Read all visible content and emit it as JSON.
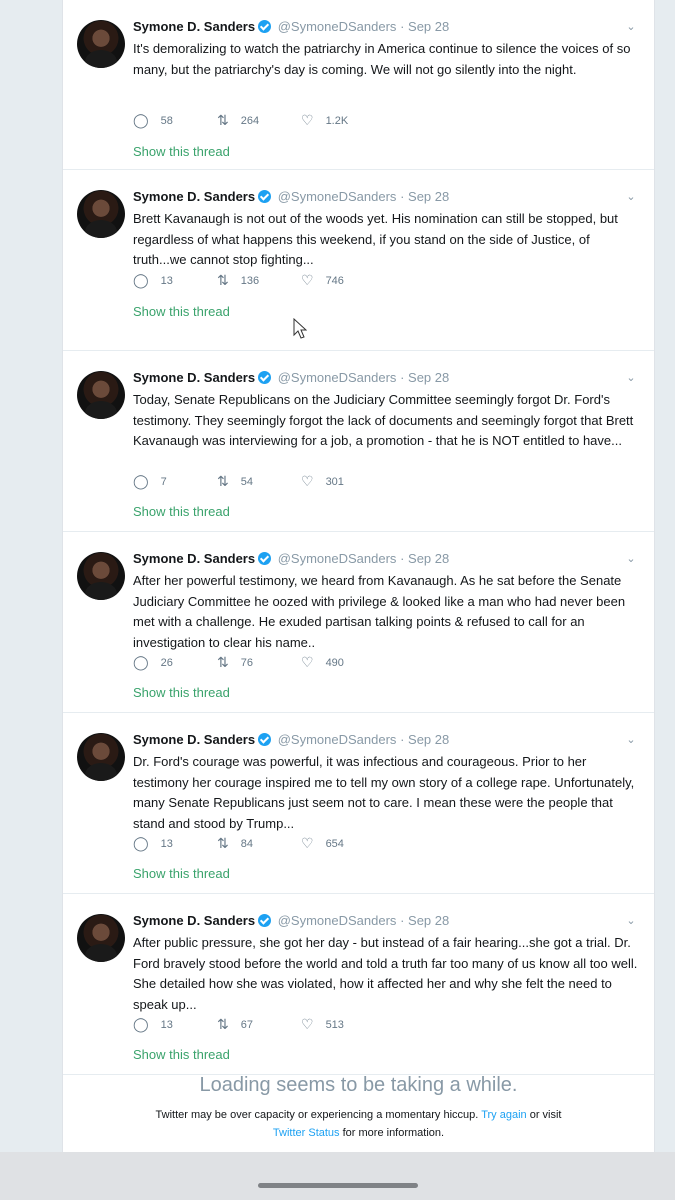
{
  "tweets": [
    {
      "name": "Symone D. Sanders",
      "handle": "@SymoneDSanders",
      "dot": "·",
      "date": "Sep 28",
      "text": "It's demoralizing to watch the patriarchy in America continue to silence the voices of so many, but the patriarchy's day is coming. We will not go silently into the night.",
      "replies": "58",
      "retweets": "264",
      "likes": "1.2K",
      "show_thread": "Show this thread"
    },
    {
      "name": "Symone D. Sanders",
      "handle": "@SymoneDSanders",
      "dot": "·",
      "date": "Sep 28",
      "text": "Brett Kavanaugh is not out of the woods yet. His nomination can still be stopped, but regardless of what happens this weekend, if you stand on the side of Justice, of truth...we cannot stop fighting...",
      "replies": "13",
      "retweets": "136",
      "likes": "746",
      "show_thread": "Show this thread"
    },
    {
      "name": "Symone D. Sanders",
      "handle": "@SymoneDSanders",
      "dot": "·",
      "date": "Sep 28",
      "text": "Today, Senate Republicans on the Judiciary Committee seemingly forgot Dr. Ford's testimony. They seemingly forgot the lack of documents and seemingly forgot that Brett Kavanaugh was interviewing for a job, a promotion - that he is NOT entitled to have...",
      "replies": "7",
      "retweets": "54",
      "likes": "301",
      "show_thread": "Show this thread"
    },
    {
      "name": "Symone D. Sanders",
      "handle": "@SymoneDSanders",
      "dot": "·",
      "date": "Sep 28",
      "text": "After her powerful testimony, we heard from Kavanaugh. As he sat before the Senate Judiciary Committee he oozed with privilege & looked like a man who had never been met with a challenge. He exuded partisan talking points & refused to call for an investigation to clear his name..",
      "replies": "26",
      "retweets": "76",
      "likes": "490",
      "show_thread": "Show this thread"
    },
    {
      "name": "Symone D. Sanders",
      "handle": "@SymoneDSanders",
      "dot": "·",
      "date": "Sep 28",
      "text": "Dr. Ford's courage was powerful, it was infectious and courageous. Prior to her testimony her courage inspired me to tell my own story of a college rape. Unfortunately, many  Senate Republicans just seem not to care. I mean these were the people that stand and stood by Trump...",
      "replies": "13",
      "retweets": "84",
      "likes": "654",
      "show_thread": "Show this thread"
    },
    {
      "name": "Symone D. Sanders",
      "handle": "@SymoneDSanders",
      "dot": "·",
      "date": "Sep 28",
      "text": "After public pressure, she got her day - but instead of a fair hearing...she got a trial. Dr. Ford bravely stood before the world and told a truth far too many of us know all too well. She detailed how she was violated, how it affected her and why she felt the need to speak up...",
      "replies": "13",
      "retweets": "67",
      "likes": "513",
      "show_thread": "Show this thread"
    }
  ],
  "loading": {
    "title": "Loading seems to be taking a while.",
    "line1_prefix": "Twitter may be over capacity or experiencing a momentary hiccup.",
    "try_again": "Try again",
    "line1_suffix": "or visit",
    "status_link": "Twitter Status",
    "line2_suffix": "for more information."
  },
  "icons": {
    "reply": "reply-icon",
    "retweet": "retweet-icon",
    "like": "heart-icon",
    "verified": "verified-badge-icon",
    "caret": "chevron-down-icon"
  },
  "colors": {
    "link_blue": "#1da1f2",
    "show_thread_green": "#3aa36c",
    "muted": "#8899a6"
  }
}
